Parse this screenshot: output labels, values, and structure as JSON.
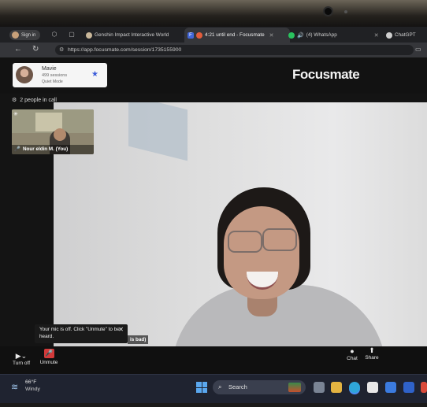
{
  "browser": {
    "profile_button": "Sign in",
    "tabs": [
      {
        "title": "Genshin Impact Interactive World",
        "active": false
      },
      {
        "title": "4:21 until end - Focusmate",
        "active": true,
        "icon": "F"
      },
      {
        "title": "(4) WhatsApp",
        "active": false
      },
      {
        "title": "ChatGPT",
        "active": false
      }
    ],
    "url": "https://app.focusmate.com/session/1735155900"
  },
  "focusmate": {
    "logo": "Focusmate",
    "user_card": {
      "name": "Mavie",
      "sessions": "499 sessions",
      "mode": "Quiet Mode"
    },
    "people_in_call": "2 people in call",
    "self_tile_label": "Nour eldin M. (You)",
    "partner_name_partial": "is bad)",
    "mic_tooltip": "Your mic is off. Click \"Unmute\" to be heard.",
    "controls": {
      "camera_label": "Turn off",
      "mic_label": "Unmute",
      "chat_label": "Chat",
      "share_label": "Share"
    }
  },
  "taskbar": {
    "temperature": "66°F",
    "weather": "Windy",
    "search_label": "Search"
  },
  "colors": {
    "accent_star": "#3a5bd9",
    "mic_off": "#d33a3a",
    "taskbar_bg": "#1f2330"
  }
}
